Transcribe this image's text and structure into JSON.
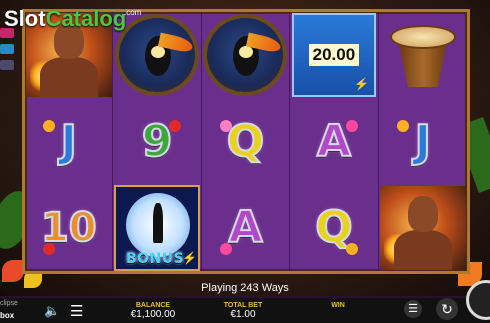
{
  "logo": {
    "slot": "Slot",
    "catalog": "Catalog",
    "com": ".com"
  },
  "reels": {
    "rows": [
      [
        {
          "type": "portrait",
          "name": "fire-dancer-icon"
        },
        {
          "type": "toucan",
          "name": "toucan-icon"
        },
        {
          "type": "toucan",
          "name": "toucan-icon"
        },
        {
          "type": "cash",
          "value": "20.00"
        },
        {
          "type": "drum",
          "name": "drum-icon"
        }
      ],
      [
        {
          "type": "letter",
          "value": "J"
        },
        {
          "type": "letter",
          "value": "9"
        },
        {
          "type": "letter",
          "value": "Q"
        },
        {
          "type": "letter",
          "value": "A"
        },
        {
          "type": "letter",
          "value": "J"
        }
      ],
      [
        {
          "type": "letter",
          "value": "10"
        },
        {
          "type": "bonus",
          "label": "BONUS"
        },
        {
          "type": "letter",
          "value": "A"
        },
        {
          "type": "letter",
          "value": "Q"
        },
        {
          "type": "portrait",
          "name": "fire-dancer-icon"
        }
      ]
    ]
  },
  "status": {
    "message": "Playing 243 Ways"
  },
  "bottombar": {
    "brand_line1": "clipse",
    "brand_line2": "box",
    "balance_label": "BALANCE",
    "balance_value": "€1,100.00",
    "totalbet_label": "TOTAL BET",
    "totalbet_value": "€1.00",
    "win_label": "WIN",
    "win_value": ""
  },
  "colors": {
    "reel_bg": "#6a2f8c",
    "frame": "#b07a2e",
    "accent_gold": "#e8c020"
  }
}
